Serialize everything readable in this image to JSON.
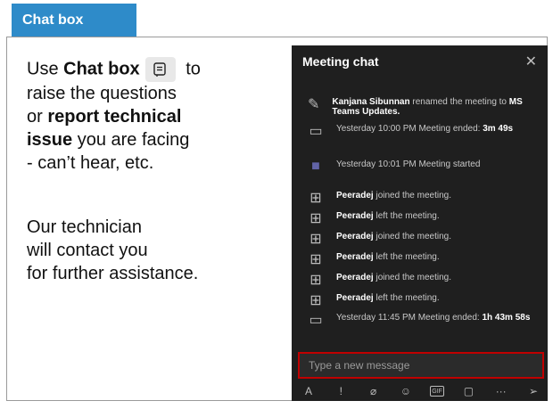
{
  "header": {
    "label": "Chat box"
  },
  "instructions": {
    "line1_prefix": "Use ",
    "line1_bold": "Chat box",
    "line1_suffix": " to",
    "line2": "raise the questions",
    "line3_prefix": "or ",
    "line3_bold": "report technical",
    "line4_bold": "issue",
    "line4_suffix": " you are facing",
    "line5": "- can’t hear, etc.",
    "line6": "Our technician",
    "line7": "will contact you",
    "line8": "for further assistance."
  },
  "chat": {
    "title": "Meeting chat",
    "messages": [
      {
        "icon": "pencil-icon",
        "bold": "Kanjana Sibunnan",
        "text": " renamed the meeting to ",
        "bold2": "MS Teams Updates."
      },
      {
        "icon": "video-ended-icon",
        "text": "Yesterday 10:00 PM  Meeting ended: ",
        "bold": "3m 49s"
      },
      {
        "icon": "video-started-icon",
        "text": "Yesterday 10:01 PM  Meeting started"
      },
      {
        "icon": "join-icon",
        "bold": "Peeradej",
        "text": " joined the meeting."
      },
      {
        "icon": "leave-icon",
        "bold": "Peeradej",
        "text": " left the meeting."
      },
      {
        "icon": "join-icon",
        "bold": "Peeradej",
        "text": " joined the meeting."
      },
      {
        "icon": "leave-icon",
        "bold": "Peeradej",
        "text": " left the meeting."
      },
      {
        "icon": "join-icon",
        "bold": "Peeradej",
        "text": " joined the meeting."
      },
      {
        "icon": "leave-icon",
        "bold": "Peeradej",
        "text": " left the meeting."
      },
      {
        "icon": "video-ended-icon",
        "text": "Yesterday 11:45 PM  Meeting ended: ",
        "bold": "1h 43m 58s"
      }
    ],
    "input_placeholder": "Type a new message",
    "toolbar": [
      "format-icon",
      "important-icon",
      "attach-icon",
      "emoji-icon",
      "gif-icon",
      "sticker-icon",
      "more-icon",
      "send-icon"
    ],
    "gif_label": "GIF",
    "more_label": "···"
  }
}
